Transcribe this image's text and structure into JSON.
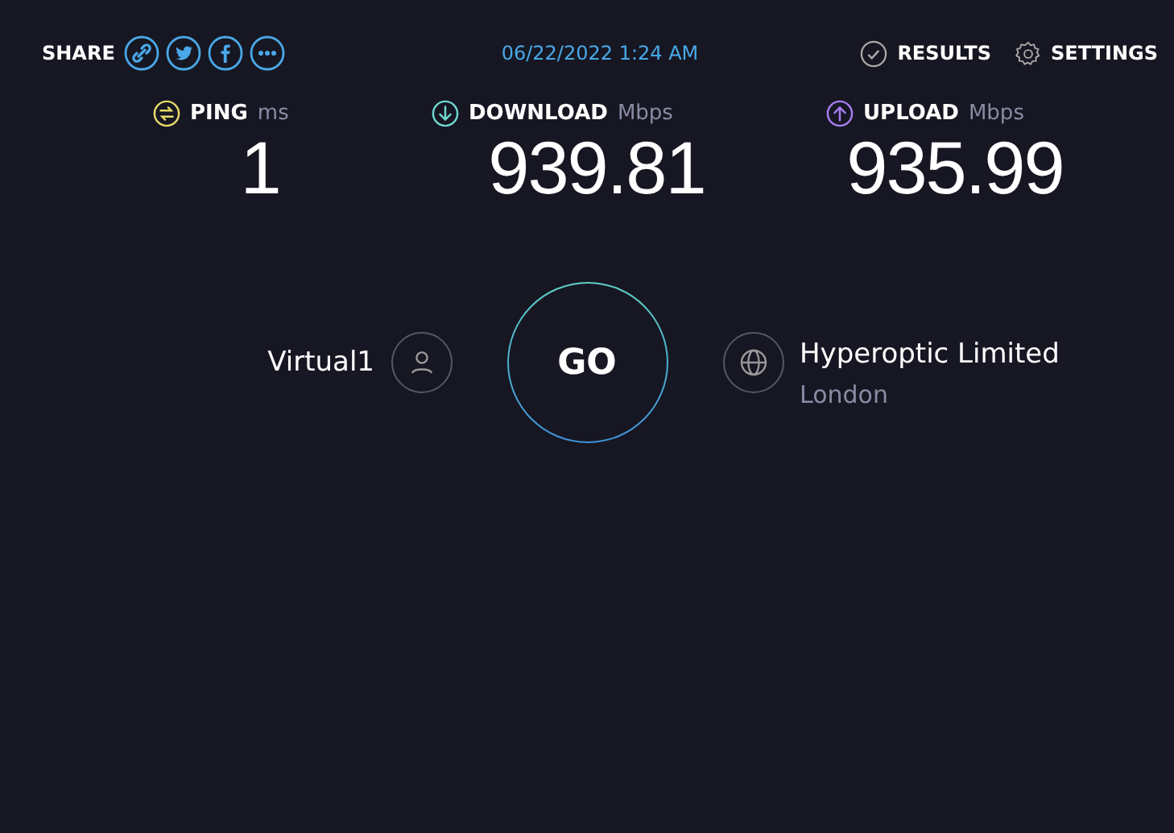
{
  "header": {
    "share_label": "SHARE",
    "share_icons": [
      {
        "kind": "link"
      },
      {
        "kind": "twitter"
      },
      {
        "kind": "facebook"
      },
      {
        "kind": "more"
      }
    ],
    "timestamp": "06/22/2022 1:24 AM",
    "results_label": "RESULTS",
    "settings_label": "SETTINGS"
  },
  "metrics": [
    {
      "kind": "ping",
      "label": "PING",
      "unit": "ms",
      "value": "1",
      "color": "#e8d96b"
    },
    {
      "kind": "download",
      "label": "DOWNLOAD",
      "unit": "Mbps",
      "value": "939.81",
      "color": "#6fd8d0"
    },
    {
      "kind": "upload",
      "label": "UPLOAD",
      "unit": "Mbps",
      "value": "935.99",
      "color": "#a77cf0"
    }
  ],
  "client": {
    "name": "Virtual1"
  },
  "go_button": {
    "label": "GO"
  },
  "server": {
    "name": "Hyperoptic Limited",
    "location": "London"
  }
}
